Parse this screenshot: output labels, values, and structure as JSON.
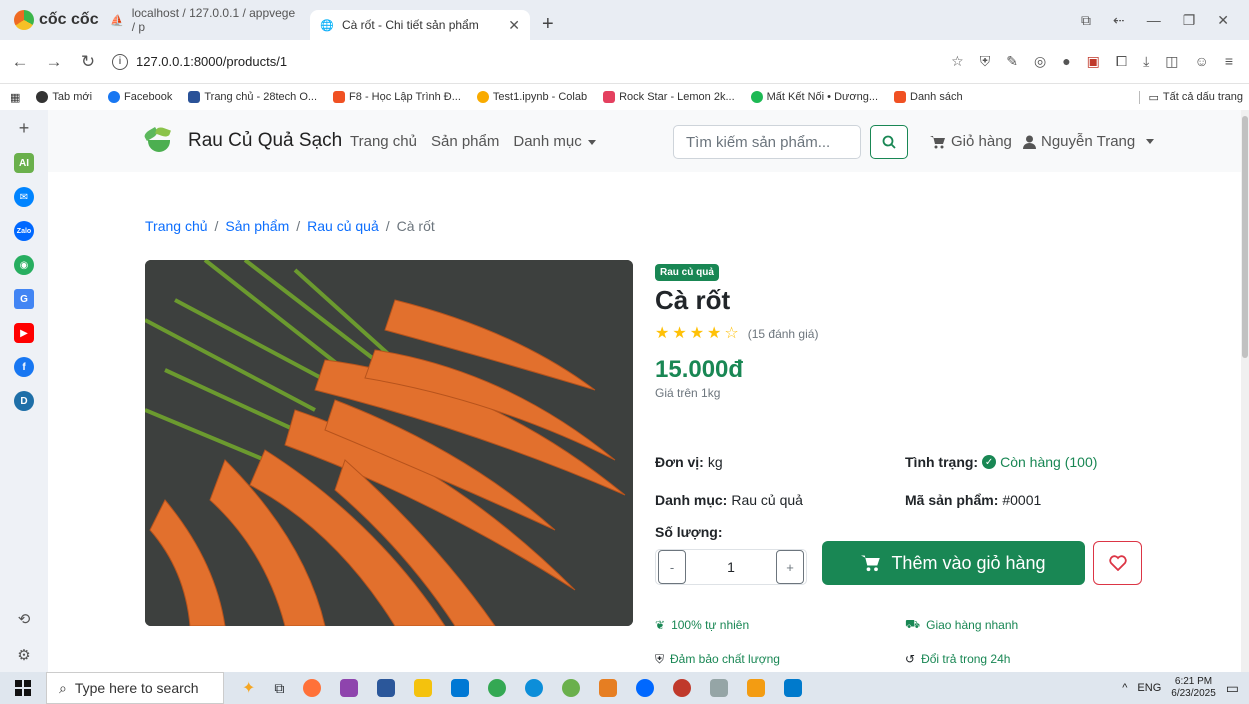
{
  "browser": {
    "brand": "cốc cốc",
    "tabs": [
      {
        "title": "localhost / 127.0.0.1 / appvege / p",
        "active": false
      },
      {
        "title": "Cà rốt - Chi tiết sản phẩm",
        "active": true
      }
    ],
    "new_tab": "+",
    "url": "127.0.0.1:8000/products/1",
    "bookmarks": [
      {
        "label": "Tab mới",
        "color": "#333333"
      },
      {
        "label": "Facebook",
        "color": "#1877f2"
      },
      {
        "label": "Trang chủ - 28tech O...",
        "color": "#2a5298"
      },
      {
        "label": "F8 - Học Lập Trình Đ...",
        "color": "#f05123"
      },
      {
        "label": "Test1.ipynb - Colab",
        "color": "#f9ab00"
      },
      {
        "label": "Rock Star - Lemon 2k...",
        "color": "#e4405f"
      },
      {
        "label": "Mất Kết Nối • Dương...",
        "color": "#1db954"
      },
      {
        "label": "Danh sách",
        "color": "#f05123"
      }
    ],
    "bookmarks_right": "Tất cả dấu trang"
  },
  "site": {
    "brand": "Rau Củ Quả Sạch",
    "nav": {
      "home": "Trang chủ",
      "products": "Sản phẩm",
      "categories": "Danh mục"
    },
    "search_placeholder": "Tìm kiếm sản phẩm...",
    "cart": "Giỏ hàng",
    "user": "Nguyễn Trang"
  },
  "breadcrumb": [
    "Trang chủ",
    "Sản phẩm",
    "Rau củ quả",
    "Cà rốt"
  ],
  "product": {
    "category_badge": "Rau củ quả",
    "name": "Cà rốt",
    "rating": 4,
    "rating_max": 5,
    "reviews": "(15 đánh giá)",
    "price": "15.000đ",
    "price_unit": "Giá trên 1kg",
    "unit_label": "Đơn vị:",
    "unit_value": "kg",
    "status_label": "Tình trạng:",
    "status_value": "Còn hàng (100)",
    "category_label": "Danh mục:",
    "category_value": "Rau củ quả",
    "sku_label": "Mã sản phẩm:",
    "sku_value": "#0001",
    "quantity_label": "Số lượng:",
    "quantity": "1",
    "minus": "-",
    "plus": "+",
    "add_to_cart": "Thêm vào giỏ hàng",
    "features": [
      "100% tự nhiên",
      "Giao hàng nhanh",
      "Đảm bảo chất lượng",
      "Đổi trả trong 24h"
    ]
  },
  "taskbar": {
    "search": "Type here to search",
    "lang": "ENG",
    "time": "6:21 PM",
    "date": "6/23/2025"
  },
  "colors": {
    "primary": "#198754",
    "danger": "#dc3545",
    "link": "#0d6efd",
    "star": "#ffc107"
  }
}
